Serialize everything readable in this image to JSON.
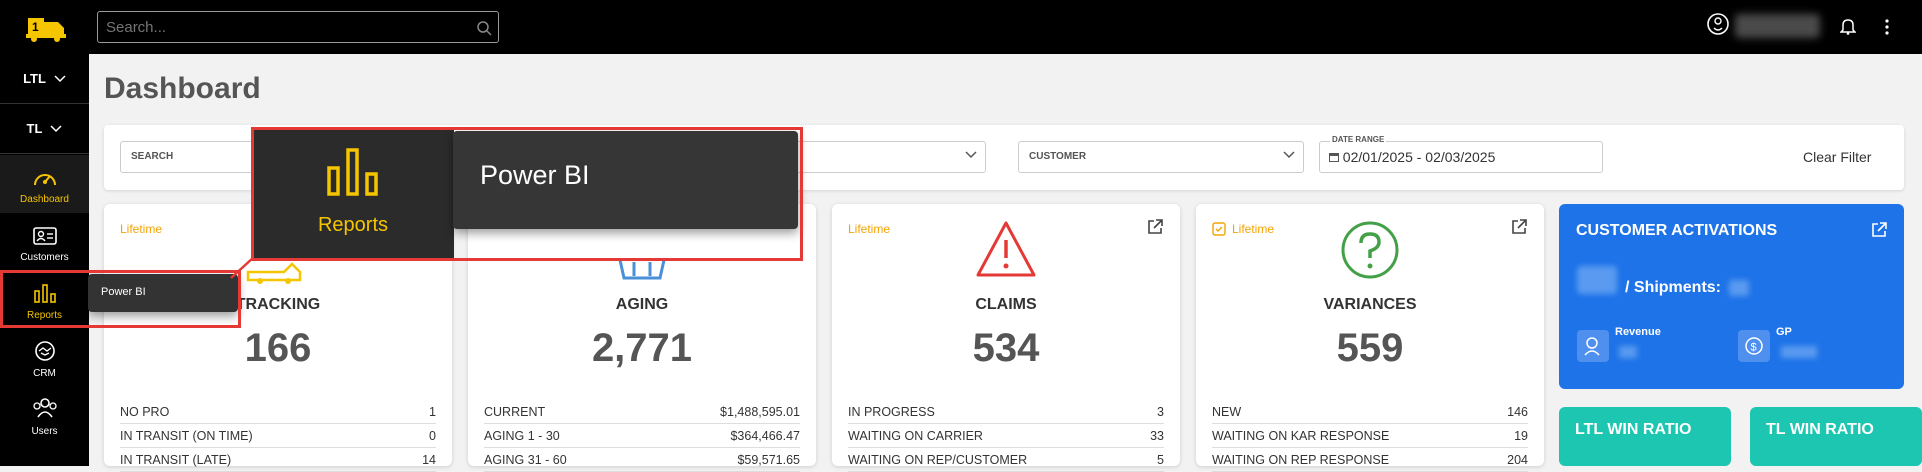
{
  "search": {
    "placeholder": "Search..."
  },
  "sidebar": {
    "dropdowns": [
      {
        "label": "LTL"
      },
      {
        "label": "TL"
      }
    ],
    "items": [
      {
        "label": "Dashboard",
        "icon": "gauge-icon"
      },
      {
        "label": "Customers",
        "icon": "customers-card-icon"
      },
      {
        "label": "Reports",
        "icon": "bar-chart-icon"
      },
      {
        "label": "CRM",
        "icon": "handshake-icon"
      },
      {
        "label": "Users",
        "icon": "users-icon"
      }
    ]
  },
  "page": {
    "title": "Dashboard"
  },
  "filters": {
    "search_label": "SEARCH",
    "customer_label": "CUSTOMER",
    "date_range_label": "DATE RANGE",
    "date_range_value": "02/01/2025 - 02/03/2025",
    "clear_label": "Clear Filter"
  },
  "cards": {
    "tracking": {
      "badge": "Lifetime",
      "title": "TRACKING",
      "count": "166",
      "rows": [
        {
          "label": "NO PRO",
          "value": "1"
        },
        {
          "label": "IN TRANSIT (ON TIME)",
          "value": "0"
        },
        {
          "label": "IN TRANSIT (LATE)",
          "value": "14"
        }
      ]
    },
    "aging": {
      "title": "AGING",
      "count": "2,771",
      "rows": [
        {
          "label": "CURRENT",
          "value": "$1,488,595.01"
        },
        {
          "label": "AGING 1 - 30",
          "value": "$364,466.47"
        },
        {
          "label": "AGING 31 - 60",
          "value": "$59,571.65"
        }
      ]
    },
    "claims": {
      "badge": "Lifetime",
      "title": "CLAIMS",
      "count": "534",
      "rows": [
        {
          "label": "IN PROGRESS",
          "value": "3"
        },
        {
          "label": "WAITING ON CARRIER",
          "value": "33"
        },
        {
          "label": "WAITING ON REP/CUSTOMER",
          "value": "5"
        }
      ]
    },
    "variances": {
      "badge": "Lifetime",
      "title": "VARIANCES",
      "count": "559",
      "rows": [
        {
          "label": "NEW",
          "value": "146"
        },
        {
          "label": "WAITING ON KAR RESPONSE",
          "value": "19"
        },
        {
          "label": "WAITING ON REP RESPONSE",
          "value": "204"
        }
      ]
    }
  },
  "activations": {
    "title": "CUSTOMER ACTIVATIONS",
    "shipments_label": "/ Shipments:",
    "revenue_label": "Revenue",
    "gp_label": "GP"
  },
  "win_ratios": {
    "ltl": "LTL WIN RATIO",
    "tl": "TL WIN RATIO"
  },
  "flyout": {
    "label": "Power BI"
  },
  "zoom": {
    "reports_label": "Reports",
    "power_bi_label": "Power BI"
  },
  "colors": {
    "accent": "#f5c500",
    "blue": "#1e73e8",
    "teal": "#1dc6b0",
    "red": "#e53935"
  }
}
